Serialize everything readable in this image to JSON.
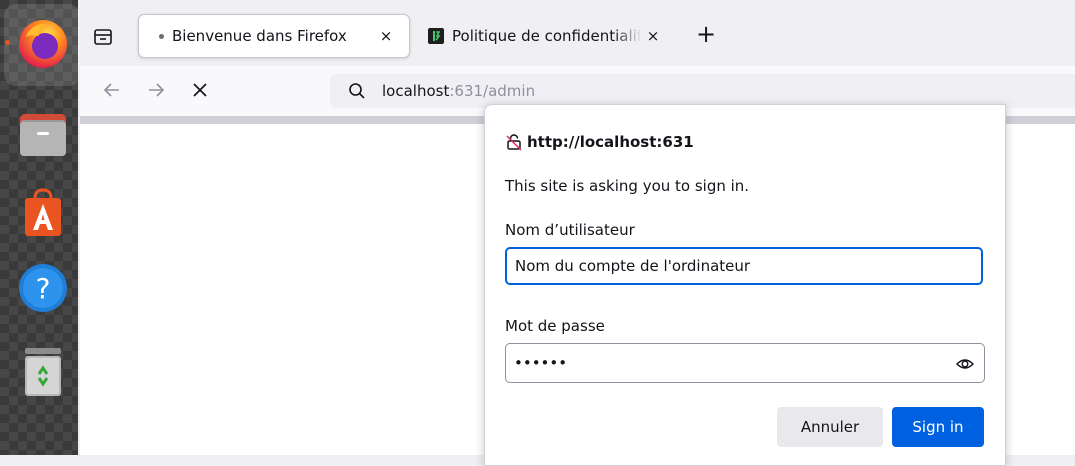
{
  "dock": {
    "apps": [
      {
        "name": "firefox-icon",
        "active": true
      },
      {
        "name": "files-icon"
      },
      {
        "name": "app-center-icon"
      },
      {
        "name": "help-icon"
      },
      {
        "name": "trash-icon"
      }
    ]
  },
  "tabs": [
    {
      "title": "Bienvenue dans Firefox",
      "active": true,
      "close": "×"
    },
    {
      "title": "Politique de confidentialité",
      "active": false,
      "close": "×"
    }
  ],
  "new_tab_label": "+",
  "urlbar": {
    "host": "localhost",
    "rest": ":631/admin"
  },
  "dialog": {
    "origin": "http://localhost:631",
    "message": "This site is asking you to sign in.",
    "username_label": "Nom d’utilisateur",
    "username_value": "Nom du compte de l'ordinateur",
    "password_label": "Mot de passe",
    "password_value": "••••••",
    "cancel_label": "Annuler",
    "signin_label": "Sign in"
  },
  "colors": {
    "accent": "#0061e0",
    "firefox_orange": "#e95420"
  }
}
